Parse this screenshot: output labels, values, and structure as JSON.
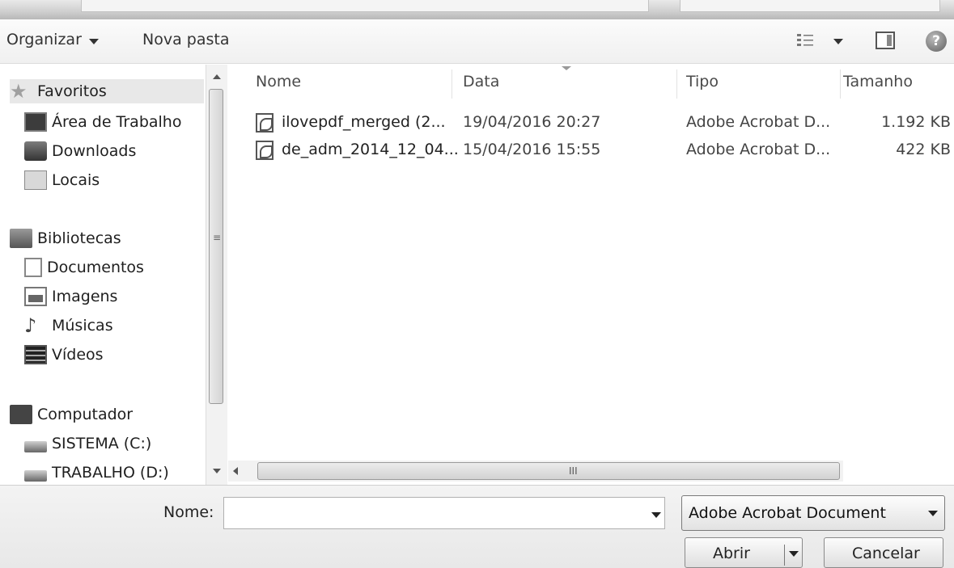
{
  "toolbar": {
    "organize_label": "Organizar",
    "new_folder_label": "Nova pasta"
  },
  "nav": {
    "items": [
      {
        "label": "Favoritos",
        "icon": "star-icon"
      },
      {
        "label": "Área de Trabalho",
        "icon": "desktop-icon"
      },
      {
        "label": "Downloads",
        "icon": "downloads-icon"
      },
      {
        "label": "Locais",
        "icon": "places-icon"
      },
      {
        "label": "Bibliotecas",
        "icon": "libraries-icon"
      },
      {
        "label": "Documentos",
        "icon": "documents-icon"
      },
      {
        "label": "Imagens",
        "icon": "images-icon"
      },
      {
        "label": "Músicas",
        "icon": "music-icon"
      },
      {
        "label": "Vídeos",
        "icon": "videos-icon"
      },
      {
        "label": "Computador",
        "icon": "computer-icon"
      },
      {
        "label": "SISTEMA (C:)",
        "icon": "drive-icon"
      },
      {
        "label": "TRABALHO (D:)",
        "icon": "drive-icon"
      }
    ]
  },
  "list": {
    "columns": [
      "Nome",
      "Data",
      "Tipo",
      "Tamanho"
    ],
    "rows": [
      {
        "name": "ilovepdf_merged (2...",
        "date": "19/04/2016 20:27",
        "type": "Adobe Acrobat D...",
        "size": "1.192 KB"
      },
      {
        "name": "de_adm_2014_12_04...",
        "date": "15/04/2016 15:55",
        "type": "Adobe Acrobat D...",
        "size": "422 KB"
      }
    ]
  },
  "footer": {
    "name_label": "Nome:",
    "name_value": "",
    "file_type": "Adobe Acrobat Document",
    "open_label": "Abrir",
    "cancel_label": "Cancelar"
  },
  "scroll_glyphs": {
    "vertical_grip": "≡",
    "horizontal_grip": "III"
  },
  "help_glyph": "?"
}
